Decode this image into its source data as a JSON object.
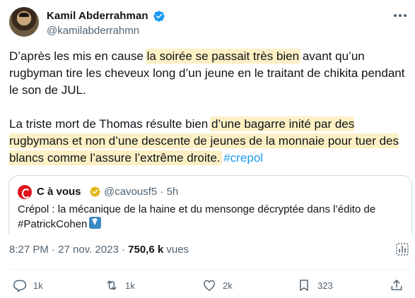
{
  "author": {
    "display_name": "Kamil Abderrahman",
    "handle": "@kamilabderrahmn",
    "verified": true,
    "verified_color": "#1d9bf0"
  },
  "body": {
    "p1_a": "D’après les mis en cause ",
    "p1_hl": "la soirée se passait très bien",
    "p1_b": " avant qu’un rugbyman tire les cheveux long d’un jeune en le traitant de chikita pendant le son de JUL.",
    "p2_a": "La triste mort de Thomas résulte bien ",
    "p2_hl": "d’une bagarre inité par des rugbymans et non d’une descente de jeunes de la monnaie pour tuer des blancs comme l’assure l’extrême droite.",
    "p2_space": " ",
    "hashtag": "#crepol",
    "highlight_color": "#fdf0c4",
    "link_color": "#1d9bf0"
  },
  "quote": {
    "name": "C à vous",
    "badge_color": "#e2b719",
    "handle_time": "@cavousf5 · 5h",
    "text": "Crépol : la mécanique de la haine et du mensonge décryptée dans l’édito de #PatrickCohen",
    "emoji": "down-arrow-emoji"
  },
  "meta": {
    "time_date": "8:27 PM · 27 nov. 2023 · ",
    "views_count": "750,6 k",
    "views_label": " vues"
  },
  "actions": {
    "reply_count": "1k",
    "retweet_count": "1k",
    "like_count": "2k",
    "bookmark_count": "323"
  }
}
